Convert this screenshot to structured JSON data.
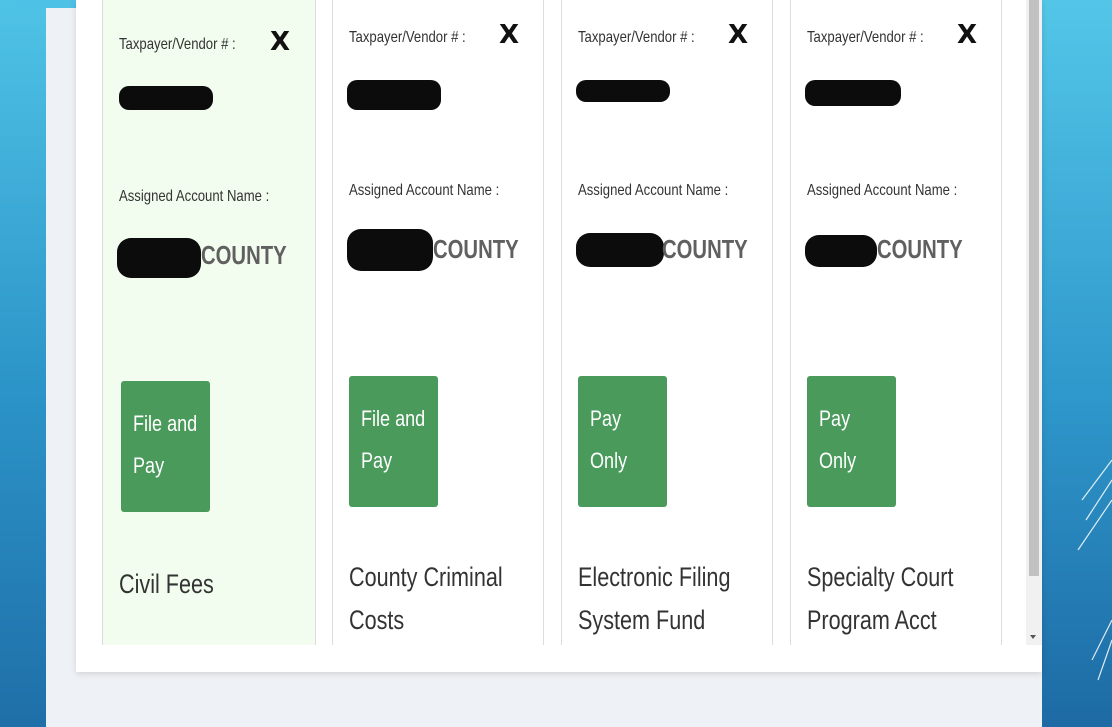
{
  "labels": {
    "taxpayer": "Taxpayer/Vendor # :",
    "assigned": "Assigned Account Name :",
    "remove_icon": "X"
  },
  "cards": [
    {
      "county_suffix": "COUNTY",
      "button": {
        "line1": "File and",
        "line2": "Pay"
      },
      "fund": {
        "line1": "Civil Fees",
        "line2": ""
      },
      "selected": true
    },
    {
      "county_suffix": "COUNTY",
      "button": {
        "line1": "File and",
        "line2": "Pay"
      },
      "fund": {
        "line1": "County Criminal",
        "line2": "Costs"
      },
      "selected": false
    },
    {
      "county_suffix": "COUNTY",
      "button": {
        "line1": "Pay",
        "line2": "Only"
      },
      "fund": {
        "line1": "Electronic Filing",
        "line2": "System Fund"
      },
      "selected": false
    },
    {
      "county_suffix": "COUNTY",
      "button": {
        "line1": "Pay",
        "line2": "Only"
      },
      "fund": {
        "line1": "Specialty Court",
        "line2": "Program Acct"
      },
      "selected": false
    }
  ],
  "colors": {
    "button_green": "#4a9a5c",
    "selected_bg": "#f3fdef",
    "accent_blue": "#2b93c7"
  }
}
